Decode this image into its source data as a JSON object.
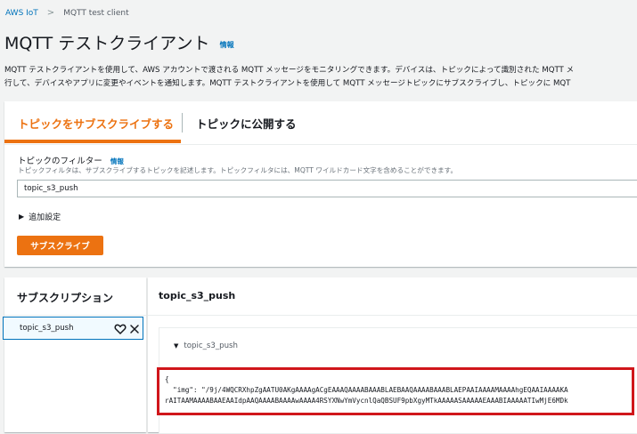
{
  "breadcrumb": {
    "root": "AWS IoT",
    "separator": ">",
    "current": "MQTT test client"
  },
  "header": {
    "title": "MQTT テストクライアント",
    "info": "情報"
  },
  "description": {
    "line1": "MQTT テストクライアントを使用して、AWS アカウントで渡される MQTT メッセージをモニタリングできます。デバイスは、トピックによって識別された MQTT メ",
    "line2": "行して、デバイスやアプリに変更やイベントを通知します。MQTT テストクライアントを使用して MQTT メッセージトピックにサブスクライブし、トピックに MQT"
  },
  "tabs": [
    {
      "label": "トピックをサブスクライブする",
      "active": true
    },
    {
      "label": "トピックに公開する",
      "active": false
    }
  ],
  "filter": {
    "label": "トピックのフィルター",
    "info": "情報",
    "hint": "トピックフィルタは、サブスクライブするトピックを記述します。トピックフィルタには、MQTT ワイルドカード文字を含めることができます。",
    "value": "topic_s3_push"
  },
  "advanced": {
    "label": "追加設定"
  },
  "subscribe_button": "サブスクライブ",
  "subscriptions": {
    "title": "サブスクリプション",
    "items": [
      {
        "label": "topic_s3_push"
      }
    ]
  },
  "messages": {
    "topic_title": "topic_s3_push",
    "message_topic": "topic_s3_push",
    "payload": {
      "line1": "{",
      "line2": "  \"img\": \"/9j/4WQCRXhpZgAATU0AKgAAAAgACgEAAAQAAAABAAABLAEBAAQAAAABAAABLAEPAAIAAAAMAAAAhgEQAAIAAAAKA",
      "line3": "rAITAAMAAAABAAEAAIdpAAQAAAABAAAAwAAAA4RSYXNwYmVycnlQaQBSUF9pbXgyMTkAAAAASAAAAAEAAABIAAAAATIwMjE6MDk"
    }
  },
  "colors": {
    "accent": "#ec7211",
    "link": "#0073bb",
    "highlight_border": "#d0161b"
  }
}
